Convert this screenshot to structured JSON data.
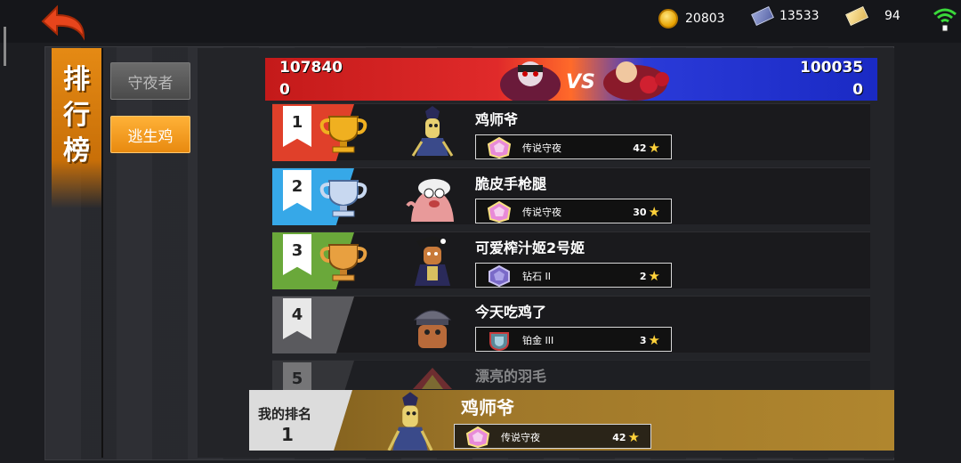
{
  "header": {
    "resources": [
      {
        "icon": "gold-coin-icon",
        "value": "20803"
      },
      {
        "icon": "blue-ticket-icon",
        "value": "13533"
      },
      {
        "icon": "gold-ticket-icon",
        "value": "94"
      }
    ]
  },
  "title": {
    "chars": [
      "排",
      "行",
      "榜"
    ]
  },
  "tabs": [
    {
      "label": "守夜者",
      "active": false
    },
    {
      "label": "逃生鸡",
      "active": true
    }
  ],
  "versus": {
    "left_score": "107840",
    "left_sub": "0",
    "right_score": "100035",
    "right_sub": "0"
  },
  "leaderboard": [
    {
      "rank": "1",
      "name": "鸡师爷",
      "tier": "传说守夜",
      "stars": "42",
      "color": "#e0402a",
      "trophy": "gold"
    },
    {
      "rank": "2",
      "name": "脆皮手枪腿",
      "tier": "传说守夜",
      "stars": "30",
      "color": "#36a8e8",
      "trophy": "silver"
    },
    {
      "rank": "3",
      "name": "可爱榨汁姬2号姬",
      "tier": "钻石 II",
      "stars": "2",
      "color": "#6aa83a",
      "trophy": "bronze"
    },
    {
      "rank": "4",
      "name": "今天吃鸡了",
      "tier": "铂金 III",
      "stars": "3",
      "color": "#5a5a5e",
      "trophy": "none"
    },
    {
      "rank": "5",
      "name": "漂亮的羽毛",
      "tier": "",
      "stars": "",
      "color": "#4a4a4e",
      "trophy": "none"
    }
  ],
  "my_rank": {
    "label": "我的排名",
    "rank": "1",
    "name": "鸡师爷",
    "tier": "传说守夜",
    "stars": "42"
  }
}
